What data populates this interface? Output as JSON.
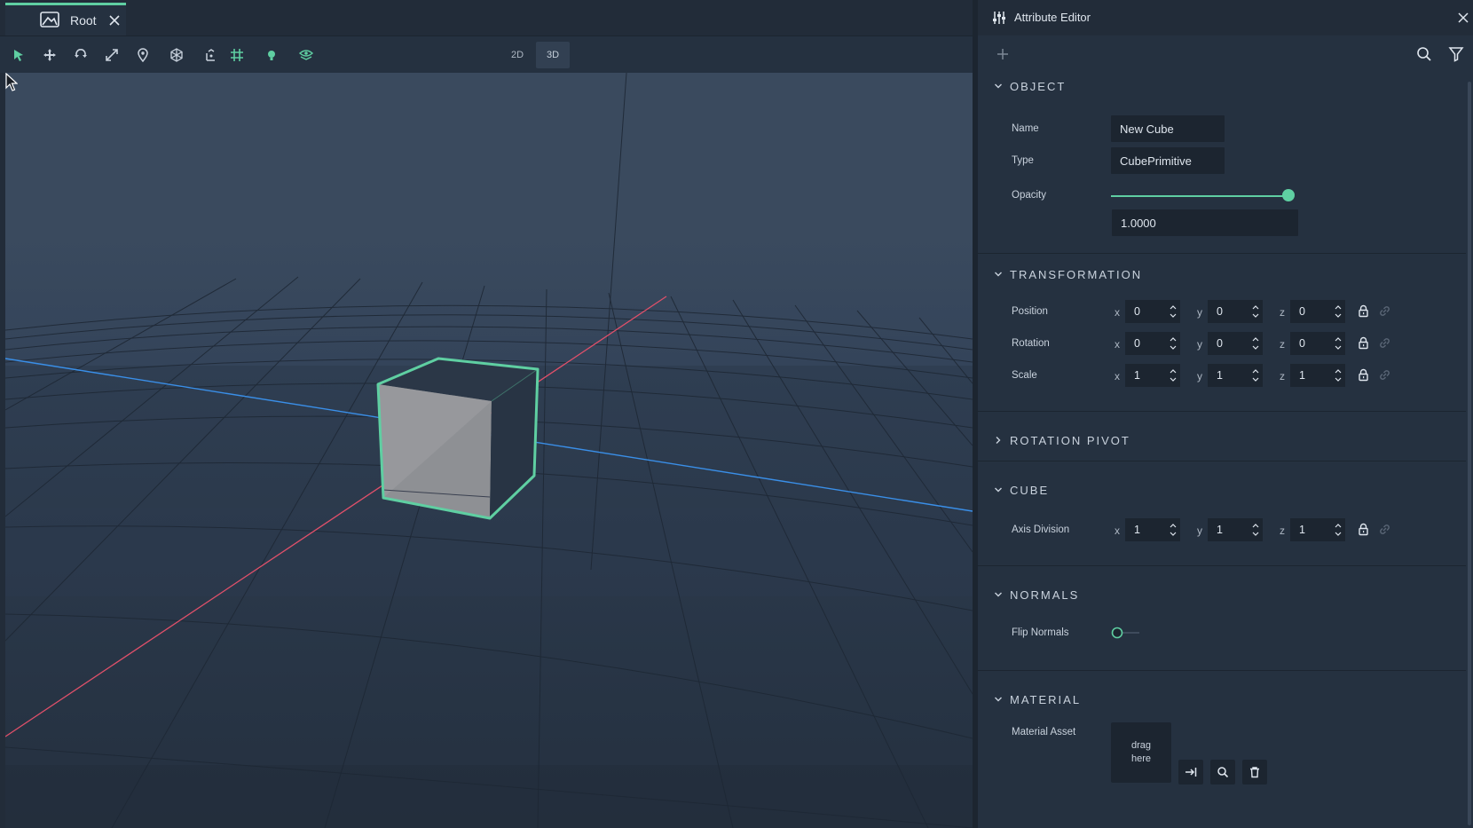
{
  "tab": {
    "label": "Root"
  },
  "toolbar": {
    "tools": [
      "select-tool",
      "move-tool",
      "rotate-tool",
      "scale-tool",
      "pin-tool",
      "mesh-tool",
      "pivot-tool",
      "grid-snap-tool",
      "light-tool",
      "camera-view-tool"
    ],
    "view_2d": "2D",
    "view_3d": "3D",
    "active_view": "3D"
  },
  "colors": {
    "accent": "#5fcfa2",
    "x_axis": "#e0506a",
    "z_axis": "#3a8fe8"
  },
  "attribute_editor": {
    "title": "Attribute Editor",
    "object": {
      "title": "OBJECT",
      "name_label": "Name",
      "name_value": "New Cube",
      "type_label": "Type",
      "type_value": "CubePrimitive",
      "opacity_label": "Opacity",
      "opacity_value": "1.0000",
      "opacity_level": 1.0
    },
    "transformation": {
      "title": "TRANSFORMATION",
      "position_label": "Position",
      "rotation_label": "Rotation",
      "scale_label": "Scale",
      "position": {
        "x": "0",
        "y": "0",
        "z": "0"
      },
      "rotation": {
        "x": "0",
        "y": "0",
        "z": "0"
      },
      "scale": {
        "x": "1",
        "y": "1",
        "z": "1"
      }
    },
    "rotation_pivot": {
      "title": "ROTATION PIVOT"
    },
    "cube": {
      "title": "CUBE",
      "axis_division_label": "Axis Division",
      "axis_division": {
        "x": "1",
        "y": "1",
        "z": "1"
      }
    },
    "normals": {
      "title": "NORMALS",
      "flip_label": "Flip Normals",
      "flip_value": false
    },
    "material": {
      "title": "MATERIAL",
      "asset_label": "Material Asset",
      "drop_line1": "drag",
      "drop_line2": "here"
    },
    "axes": {
      "x": "x",
      "y": "y",
      "z": "z"
    }
  }
}
